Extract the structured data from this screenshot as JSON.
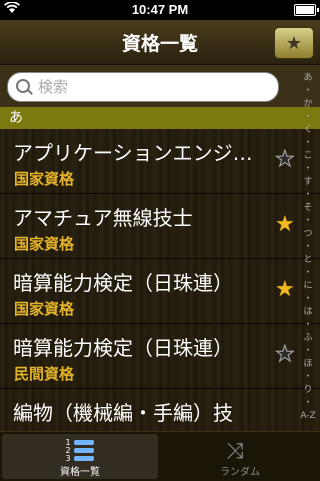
{
  "statusbar": {
    "carrier_icon": "wifi-icon",
    "time": "10:47 PM",
    "battery": "battery-icon"
  },
  "navbar": {
    "title": "資格一覧",
    "fav_icon": "star-icon"
  },
  "search": {
    "placeholder": "検索"
  },
  "section": {
    "label": "あ"
  },
  "rows": [
    {
      "name": "アプリケーションエンジニア",
      "category": "国家資格",
      "starred": false
    },
    {
      "name": "アマチュア無線技士",
      "category": "国家資格",
      "starred": true
    },
    {
      "name": "暗算能力検定（日珠連）",
      "category": "国家資格",
      "starred": true
    },
    {
      "name": "暗算能力検定（日珠連）",
      "category": "民間資格",
      "starred": false
    },
    {
      "name": "編物（機械編・手編）技",
      "category": "",
      "starred": false
    }
  ],
  "index_letters": [
    "あ",
    "・",
    "か",
    "・",
    "く",
    "・",
    "こ",
    "・",
    "す",
    "・",
    "そ",
    "・",
    "つ",
    "・",
    "と",
    "・",
    "に",
    "・",
    "は",
    "・",
    "ふ",
    "・",
    "ほ",
    "・",
    "り",
    "・",
    "A-Z"
  ],
  "tabs": [
    {
      "label": "資格一覧",
      "icon": "list-icon",
      "numbers": [
        "1",
        "2",
        "3"
      ]
    },
    {
      "label": "ランダム",
      "icon": "shuffle-icon"
    }
  ],
  "colors": {
    "accent": "#e3b32a",
    "section": "#7a7a10",
    "star": "#f2b820"
  }
}
